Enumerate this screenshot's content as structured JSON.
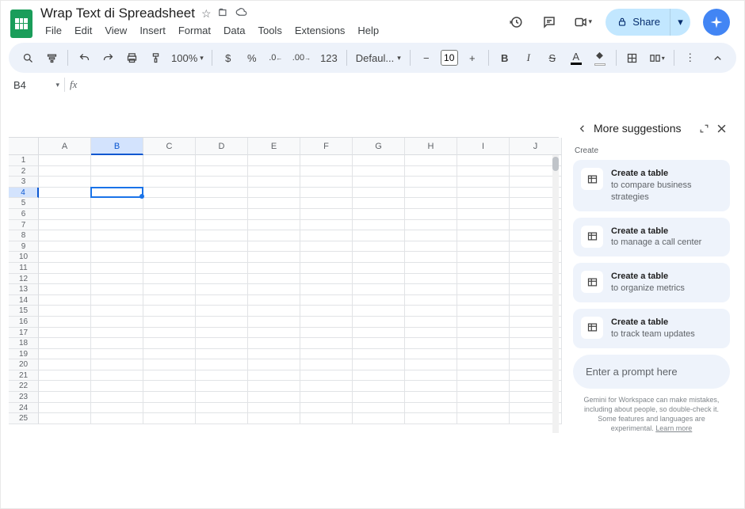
{
  "doc": {
    "title": "Wrap Text di Spreadsheet"
  },
  "menus": [
    "File",
    "Edit",
    "View",
    "Insert",
    "Format",
    "Data",
    "Tools",
    "Extensions",
    "Help"
  ],
  "share": {
    "label": "Share"
  },
  "toolbar": {
    "zoom": "100%",
    "fontname": "Defaul...",
    "fontsize": "10"
  },
  "namebox": {
    "ref": "B4"
  },
  "columns": [
    "A",
    "B",
    "C",
    "D",
    "E",
    "F",
    "G",
    "H",
    "I",
    "J"
  ],
  "rowCount": 25,
  "selectedColIndex": 1,
  "selectedRowIndex": 3,
  "sidepanel": {
    "title": "More suggestions",
    "section": "Create",
    "suggestions": [
      {
        "title": "Create a table",
        "sub": "to compare business strategies"
      },
      {
        "title": "Create a table",
        "sub": "to manage a call center"
      },
      {
        "title": "Create a table",
        "sub": "to organize metrics"
      },
      {
        "title": "Create a table",
        "sub": "to track team updates"
      }
    ],
    "prompt_placeholder": "Enter a prompt here",
    "disclaimer_a": "Gemini for Workspace can make mistakes, including about people, so double-check it. Some features and languages are experimental. ",
    "disclaimer_link": "Learn more"
  }
}
